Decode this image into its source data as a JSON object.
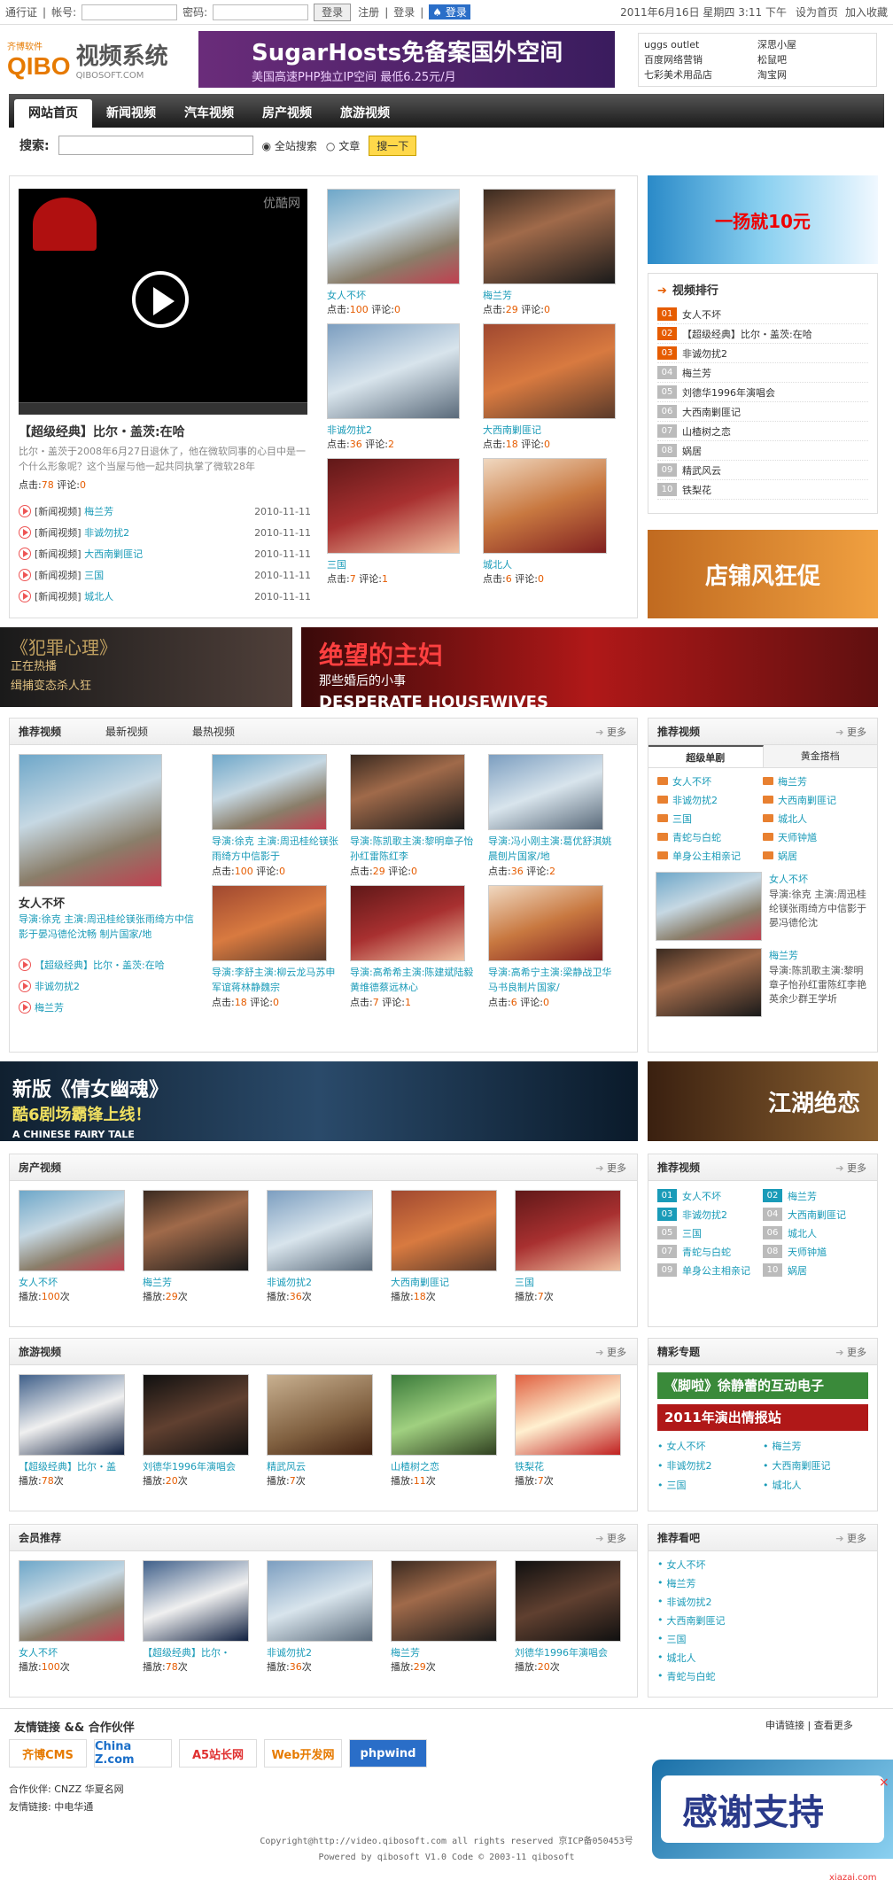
{
  "topbar": {
    "left": "通行证",
    "acct": "帐号:",
    "pwd": "密码:",
    "login": "登录",
    "reg": "注册",
    "login2": "登录",
    "qq": "登录",
    "date": "2011年6月16日 星期四 3:11 下午",
    "home": "设为首页",
    "fav": "加入收藏"
  },
  "brand": {
    "logo_q": "QIBO",
    "logo_cn": "齐博软件",
    "logo_t": "视频系统",
    "logo_s": "QIBOSOFT.COM",
    "banner_h": "SugarHosts免备案国外空间",
    "banner_sub": "美国高速PHP独立IP空间 最低6.25元/月",
    "links": [
      "uggs outlet",
      "深思小屋",
      "百度网络营销",
      "松鼠吧",
      "七彩美术用品店",
      "淘宝网"
    ]
  },
  "nav": [
    "网站首页",
    "新闻视频",
    "汽车视频",
    "房产视频",
    "旅游视频"
  ],
  "search": {
    "label": "搜索:",
    "opt1": "全站搜索",
    "opt2": "文章",
    "go": "搜一下"
  },
  "featured": {
    "watermark": "优酷网",
    "title": "【超级经典】比尔・盖茨:在哈",
    "desc": "比尔・盖茨于2008年6月27日退休了，他在微软同事的心目中是一个什么形象呢？这个当屋与他一起共同执掌了微软28年",
    "hits_label": "点击:",
    "hits": "78",
    "com_label": "评论:",
    "com": "0"
  },
  "news": [
    {
      "tag": "[新闻视频]",
      "t": "梅兰芳",
      "d": "2010-11-11"
    },
    {
      "tag": "[新闻视频]",
      "t": "非诚勿扰2",
      "d": "2010-11-11"
    },
    {
      "tag": "[新闻视频]",
      "t": "大西南剿匪记",
      "d": "2010-11-11"
    },
    {
      "tag": "[新闻视频]",
      "t": "三国",
      "d": "2010-11-11"
    },
    {
      "tag": "[新闻视频]",
      "t": "城北人",
      "d": "2010-11-11"
    }
  ],
  "thumbs": [
    {
      "t": "女人不坏",
      "h": "100",
      "c": "0"
    },
    {
      "t": "梅兰芳",
      "h": "29",
      "c": "0"
    },
    {
      "t": "非诚勿扰2",
      "h": "36",
      "c": "2"
    },
    {
      "t": "大西南剿匪记",
      "h": "18",
      "c": "0"
    },
    {
      "t": "三国",
      "h": "7",
      "c": "1"
    },
    {
      "t": "城北人",
      "h": "6",
      "c": "0"
    }
  ],
  "labels": {
    "hits": "点击:",
    "com": "评论:",
    "play": "播放:",
    "times": "次",
    "more": "更多"
  },
  "ad_side1": "一扬就10元",
  "rank": {
    "title": "视频排行",
    "items": [
      "女人不坏",
      "【超级经典】比尔・盖茨:在哈",
      "非诚勿扰2",
      "梅兰芳",
      "刘德华1996年演唱会",
      "大西南剿匪记",
      "山楂树之恋",
      "娲居",
      "精武风云",
      "铁梨花"
    ]
  },
  "ad_side2": "店铺风狂促",
  "ad_row1a": {
    "h": "《犯罪心理》",
    "l1": "正在热播",
    "l2": "缉捕变态杀人狂"
  },
  "ad_row1b": {
    "h": "绝望的主妇",
    "sub": "那些婚后的小事",
    "en": "DESPERATE HOUSEWIVES"
  },
  "rec": {
    "tabs": [
      "推荐视频",
      "最新视频",
      "最热视频"
    ],
    "big_title": "女人不坏",
    "big_desc": "导演:徐克 主演:周迅桂纶镁张雨绮方中信影于晏冯德伦沈畅 制片国家/地",
    "list": [
      "【超级经典】比尔・盖茨:在哈",
      "非诚勿扰2",
      "梅兰芳"
    ],
    "grid": [
      {
        "d": "导演:徐克 主演:周迅桂纶镁张雨绮方中信影于",
        "h": "100",
        "c": "0"
      },
      {
        "d": "导演:陈凯歌主演:黎明章子怡孙红雷陈红李",
        "h": "29",
        "c": "0"
      },
      {
        "d": "导演:冯小刚主演:葛优舒淇姚晨刨片国家/地",
        "h": "36",
        "c": "2"
      },
      {
        "d": "导演:李舒主演:柳云龙马苏申军谊蒋林静魏宗",
        "h": "18",
        "c": "0"
      },
      {
        "d": "导演:高希希主演:陈建斌陆毅黄维德蔡远林心",
        "h": "7",
        "c": "1"
      },
      {
        "d": "导演:高希宁主演:梁静战卫华马书良制片国家/",
        "h": "6",
        "c": "0"
      }
    ]
  },
  "rec_side": {
    "title": "推荐视频",
    "tabs": [
      "超级单剧",
      "黄金搭档"
    ],
    "items": [
      "女人不坏",
      "梅兰芳",
      "非诚勿扰2",
      "大西南剿匪记",
      "三国",
      "城北人",
      "青蛇与白蛇",
      "天师钟馗",
      "单身公主相亲记",
      "娲居"
    ],
    "cards": [
      {
        "t": "女人不坏",
        "d": "导演:徐克 主演:周迅桂纶镁张雨绮方中信影于晏冯德伦沈"
      },
      {
        "t": "梅兰芳",
        "d": "导演:陈凯歌主演:黎明章子怡孙红雷陈红李艳英余少群王学圻"
      }
    ]
  },
  "ad_row2a": {
    "h": "新版《倩女幽魂》",
    "sub": "酷6剧场霸锋上线！",
    "en": "A CHINESE FAIRY TALE"
  },
  "ad_row2b": "江湖绝恋",
  "house": {
    "title": "房产视频",
    "items": [
      {
        "t": "女人不坏",
        "p": "100"
      },
      {
        "t": "梅兰芳",
        "p": "29"
      },
      {
        "t": "非诚勿扰2",
        "p": "36"
      },
      {
        "t": "大西南剿匪记",
        "p": "18"
      },
      {
        "t": "三国",
        "p": "7"
      }
    ]
  },
  "rec2": {
    "title": "推荐视频",
    "items": [
      "梅兰芳",
      "非诚勿扰2",
      "大西南剿匪记",
      "三国",
      "城北人",
      "青蛇与白蛇",
      "天师钟馗",
      "单身公主相亲记",
      "娲居"
    ],
    "first": "女人不坏"
  },
  "travel": {
    "title": "旅游视频",
    "items": [
      {
        "t": "【超级经典】比尔・盖",
        "p": "78"
      },
      {
        "t": "刘德华1996年演唱会",
        "p": "20"
      },
      {
        "t": "精武风云",
        "p": "7"
      },
      {
        "t": "山楂树之恋",
        "p": "11"
      },
      {
        "t": "铁梨花",
        "p": "7"
      }
    ]
  },
  "special": {
    "title": "精彩专题",
    "ad1": "《脚啦》徐静蕾的互动电子",
    "ad2": "2011年演出情报站",
    "items": [
      "女人不坏",
      "梅兰芳",
      "非诚勿扰2",
      "大西南剿匪记",
      "三国",
      "城北人"
    ]
  },
  "member": {
    "title": "会员推荐",
    "items": [
      {
        "t": "女人不坏",
        "p": "100"
      },
      {
        "t": "【超级经典】比尔・",
        "p": "78"
      },
      {
        "t": "非诚勿扰2",
        "p": "36"
      },
      {
        "t": "梅兰芳",
        "p": "29"
      },
      {
        "t": "刘德华1996年演唱会",
        "p": "20"
      }
    ]
  },
  "recwatch": {
    "title": "推荐看吧",
    "items": [
      "女人不坏",
      "梅兰芳",
      "非诚勿扰2",
      "大西南剿匪记",
      "三国",
      "城北人",
      "青蛇与白蛇"
    ]
  },
  "links": {
    "title": "友情链接 && 合作伙伴",
    "apply": "申请链接",
    "all": "查看更多",
    "logos": [
      "齐博CMS",
      "China Z.com",
      "A5站长网",
      "Web开发网",
      "phpwind"
    ],
    "partner": "合作伙伴: CNZZ 华夏名网",
    "friend": "友情链接: 中电华通"
  },
  "footer": {
    "l1": "Copyright@http://video.qibosoft.com all rights reserved 京ICP备050453号",
    "l2": "Powered by qibosoft V1.0 Code © 2003-11 qibosoft"
  },
  "float_ad": "感谢支持",
  "float_close": "×",
  "watermark2": "xiazai.com"
}
